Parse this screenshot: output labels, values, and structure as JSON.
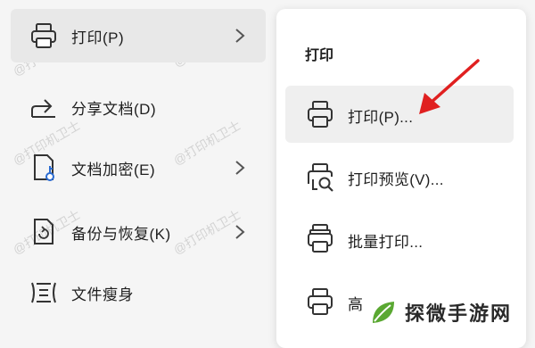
{
  "left_menu": {
    "items": [
      {
        "label": "打印(P)",
        "icon": "printer-icon",
        "has_submenu": true,
        "active": true
      },
      {
        "label": "分享文档(D)",
        "icon": "share-icon",
        "has_submenu": false
      },
      {
        "label": "文档加密(E)",
        "icon": "document-key-icon",
        "has_submenu": true
      },
      {
        "label": "备份与恢复(K)",
        "icon": "backup-restore-icon",
        "has_submenu": true
      },
      {
        "label": "文件瘦身",
        "icon": "file-slim-icon",
        "has_submenu": false
      }
    ]
  },
  "submenu": {
    "title": "打印",
    "items": [
      {
        "label": "打印(P)...",
        "icon": "printer-icon",
        "hover": true
      },
      {
        "label": "打印预览(V)...",
        "icon": "print-preview-icon"
      },
      {
        "label": "批量打印...",
        "icon": "batch-print-icon"
      },
      {
        "label": "高",
        "icon": "printer-icon"
      }
    ]
  },
  "watermark": {
    "text": "@打印机卫士"
  },
  "brand": {
    "text": "探微手游网",
    "logo_color": "#5aa832"
  },
  "colors": {
    "arrow": "#e02020",
    "active_bg": "#e8e8e8",
    "hover_bg": "#efefef"
  }
}
